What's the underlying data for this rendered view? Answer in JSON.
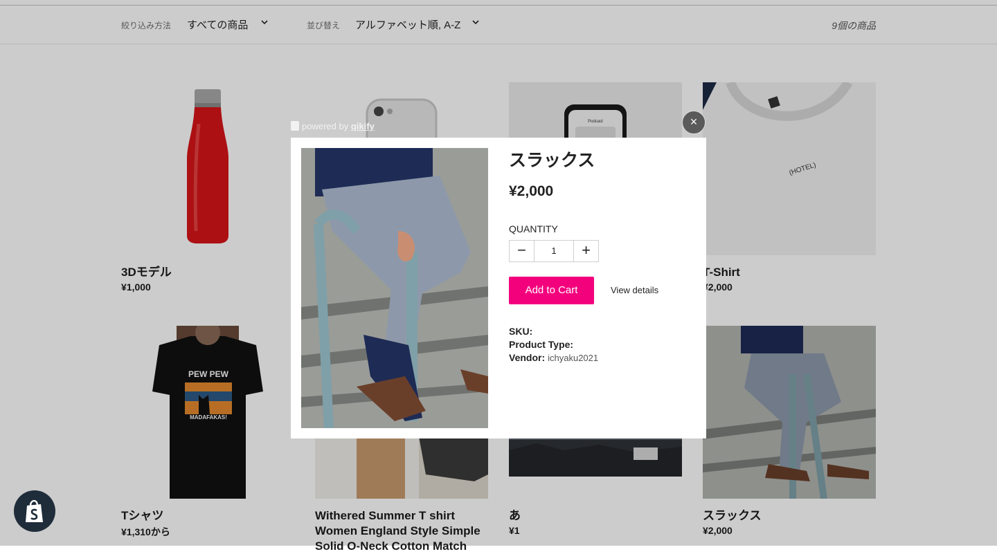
{
  "filter_bar": {
    "filter_label": "絞り込み方法",
    "filter_value": "すべての商品",
    "sort_label": "並び替え",
    "sort_value": "アルファベット順, A-Z",
    "count": "9個の商品"
  },
  "products": [
    {
      "title": "3Dモデル",
      "price": "¥1,000"
    },
    {
      "title": "T-Shirt",
      "price": "¥2,000"
    },
    {
      "title": "Tシャツ",
      "price": "¥1,310から"
    },
    {
      "title_lines": [
        "Withered Summer T shirt",
        "Women England Style Simple",
        "Solid O-Neck Cotton Match"
      ],
      "price": ""
    },
    {
      "title": "あ",
      "price": "¥1"
    },
    {
      "title": "スラックス",
      "price": "¥2,000"
    }
  ],
  "tshirt_print": {
    "line1": "PEW PEW",
    "line2": "MADAFAKAS!",
    "hotel": "(HOTEL)",
    "phone_app": "Podcast"
  },
  "modal": {
    "powered_prefix": "powered by",
    "powered_brand": "qikify",
    "close_icon": "×",
    "title": "スラックス",
    "price": "¥2,000",
    "quantity_label": "QUANTITY",
    "quantity_value": "1",
    "minus": "−",
    "plus": "+",
    "add_to_cart": "Add to Cart",
    "view_details": "View details",
    "sku_label": "SKU:",
    "type_label": "Product Type:",
    "vendor_label": "Vendor:",
    "vendor_value": "ichyaku2021"
  },
  "colors": {
    "accent": "#f3007d",
    "overlay": "rgba(0,0,0,0.2)",
    "badge": "#1f2c3a"
  }
}
